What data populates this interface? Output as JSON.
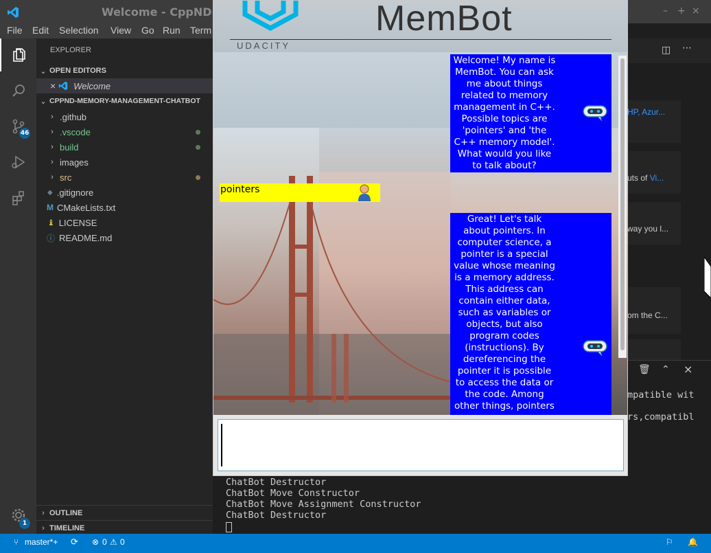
{
  "vscode": {
    "window_title": "Welcome - CppND-M",
    "window_controls": {
      "minimize": "–",
      "maximize": "+",
      "close": "×"
    },
    "menu": [
      "File",
      "Edit",
      "Selection",
      "View",
      "Go",
      "Run",
      "Term"
    ],
    "activity": {
      "explorer_icon": "files-icon",
      "search_icon": "search-icon",
      "scm_icon": "source-control-icon",
      "scm_badge": "46",
      "debug_icon": "run-debug-icon",
      "extensions_icon": "extensions-icon",
      "settings_icon": "gear-icon",
      "settings_badge": "1"
    },
    "sidebar": {
      "header": "EXPLORER",
      "open_editors_label": "OPEN EDITORS",
      "open_editor_item": "Welcome",
      "project_label": "CPPND-MEMORY-MANAGEMENT-CHATBOT",
      "tree": [
        {
          "name": ".github",
          "kind": "folder",
          "color": "#cccccc"
        },
        {
          "name": ".vscode",
          "kind": "folder",
          "color": "#73c991"
        },
        {
          "name": "build",
          "kind": "folder",
          "color": "#73c991"
        },
        {
          "name": "images",
          "kind": "folder",
          "color": "#cccccc"
        },
        {
          "name": "src",
          "kind": "folder",
          "color": "#e2c08d"
        },
        {
          "name": ".gitignore",
          "kind": "file",
          "icon": "git-icon"
        },
        {
          "name": "CMakeLists.txt",
          "kind": "file",
          "icon": "cmake-icon"
        },
        {
          "name": "LICENSE",
          "kind": "file",
          "icon": "license-icon"
        },
        {
          "name": "README.md",
          "kind": "file",
          "icon": "info-icon"
        }
      ],
      "outline_label": "OUTLINE",
      "timeline_label": "TIMELINE"
    },
    "editor_cards": [
      {
        "prefix": "",
        "link": "HP, Azur..."
      },
      {
        "prefix": "uts of ",
        "link": "Vi..."
      },
      {
        "prefix": "way you l...",
        "link": ""
      },
      {
        "prefix": "om the C...",
        "link": ""
      }
    ],
    "terminal": {
      "partial_lines": [
        "mpatible wit",
        "rs,compatibl"
      ],
      "lines": [
        "ChatBot Destructor",
        "ChatBot Move Constructor",
        "ChatBot Move Assignment Constructor",
        "ChatBot Destructor"
      ]
    },
    "statusbar": {
      "branch": "master*+",
      "errors": "0",
      "warnings": "0",
      "bg_color": "#007acc"
    }
  },
  "membot": {
    "logo_text": "UDACITY",
    "title": "MemBot",
    "messages": [
      {
        "from": "bot",
        "text": "Welcome! My name is MemBot. You can ask me about things related to memory management in C++. Possible topics are 'pointers' and 'the C++ memory model'. What would you like to talk about?"
      },
      {
        "from": "user",
        "text": "pointers"
      },
      {
        "from": "bot",
        "text": "Great! Let's talk about pointers. In computer science, a pointer is a special value whose meaning is a memory address. This address can contain either data, such as variables or objects, but also program codes (instructions). By dereferencing the pointer it is possible to access the data or the code. Among other things, pointers"
      }
    ],
    "input_value": "",
    "bot_bubble_color": "#0000ff",
    "user_bubble_color": "#ffff00"
  }
}
